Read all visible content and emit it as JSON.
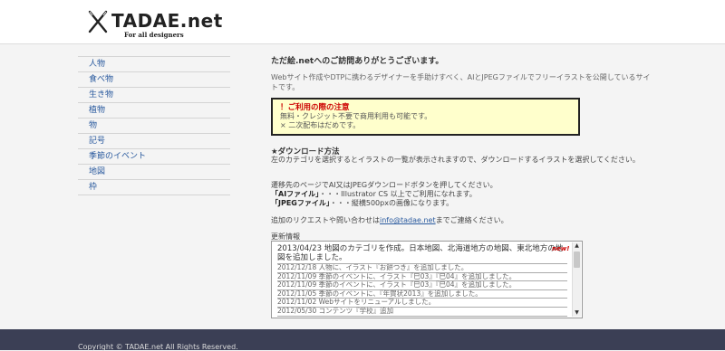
{
  "header": {
    "logo_text": "TADAE.net",
    "tagline": "For all designers",
    "logo_icon": "crossed-pens-icon"
  },
  "sidebar": {
    "items": [
      {
        "label": "人物"
      },
      {
        "label": "食べ物"
      },
      {
        "label": "生き物"
      },
      {
        "label": "植物"
      },
      {
        "label": "物"
      },
      {
        "label": "記号"
      },
      {
        "label": "季節のイベント"
      },
      {
        "label": "地図"
      },
      {
        "label": "枠"
      }
    ]
  },
  "main": {
    "welcome": "ただ絵.netへのご訪問ありがとうございます。",
    "intro": "Webサイト作成やDTPに携わるデザイナーを手助けすべく、AIとJPEGファイルでフリーイラストを公開しているサイトです。",
    "notice": {
      "title": "！ご利用の際の注意",
      "line1": "無料・クレジット不要で商用利用も可能です。",
      "line2": "× 二次配布はだめです。"
    },
    "download": {
      "title": "★ダウンロード方法",
      "text": "左のカテゴリを選択するとイラストの一覧が表示されますので、ダウンロードするイラストを選択してください。",
      "text2": "遷移先のページでAI又はJPEGダウンロードボタンを押してください。",
      "ai_label": "「AIファイル」",
      "ai_desc": "・・・Illustrator CS 以上でご利用になれます。",
      "jpeg_label": "「JPEGファイル」",
      "jpeg_desc": "・・・縦横500pxの画像になります。"
    },
    "request": {
      "prefix": "追加のリクエストや問い合わせは",
      "email": "info@tadae.net",
      "suffix": "までご連絡ください。"
    },
    "updates": {
      "title": "更新情報",
      "top": "2013/04/23 地図のカテゴリを作成。日本地図、北海道地方の地図、東北地方の地図を追加しました。",
      "new_badge": "new!",
      "rows": [
        "2012/12/18 人物に、イラスト『お餅つき』を追加しました。",
        "2012/11/09 季節のイベントに、イラスト『巳03』『巳04』を追加しました。",
        "2012/11/09 季節のイベントに、イラスト『巳03』『巳04』を追加しました。",
        "2012/11/05 季節のイベントに、『年賀状2013』を追加しました。",
        "2012/11/02 Webサイトをリニューアルしました。",
        "2012/05/30 コンテンツ『学校』追加"
      ]
    }
  },
  "footer": {
    "text": "Copyright © TADAE.net All Rights Reserved."
  }
}
